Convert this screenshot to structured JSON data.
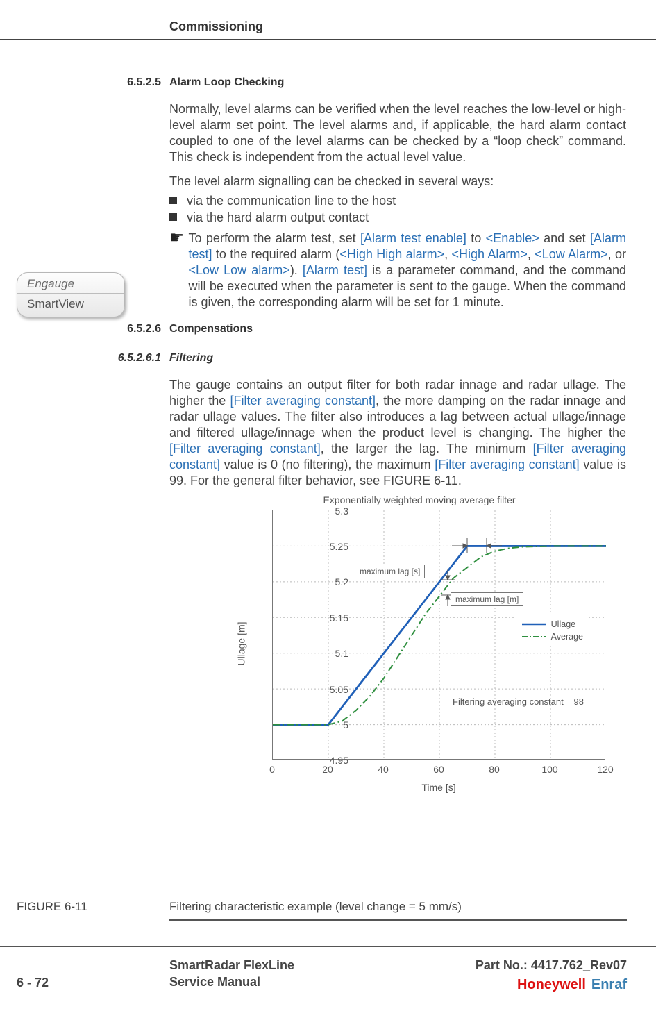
{
  "header": {
    "chapter": "Commissioning"
  },
  "badge": {
    "top": "Engauge",
    "bottom": "SmartView"
  },
  "s6525": {
    "num": "6.5.2.5",
    "title": "Alarm Loop Checking",
    "p1": "Normally, level alarms can be verified when the level reaches the low-level or high-level alarm set point. The level alarms and, if applicable, the hard alarm contact coupled to one of the level alarms can be checked by a “loop check” command. This check is independent from the actual level value.",
    "p2": "The level alarm signalling can be checked in several ways:",
    "b1": "via the communication line to the host",
    "b2": "via the hard alarm output contact",
    "tip_pre": "To perform the alarm test, set ",
    "tip_k1": "[Alarm test enable]",
    "tip_m1": " to ",
    "tip_k2": "<Enable>",
    "tip_m2": " and set ",
    "tip_k3": "[Alarm test]",
    "tip_m3": " to the required alarm (",
    "tip_k4": "<High High alarm>",
    "tip_m4": ", ",
    "tip_k5": "<High Alarm>",
    "tip_m5": ", ",
    "tip_k6": "<Low Alarm>",
    "tip_m6": ", or ",
    "tip_k7": "<Low Low alarm>",
    "tip_m7": "). ",
    "tip_k8": "[Alarm test]",
    "tip_m8": " is a parameter command, and the command will be executed when the parameter is sent to the gauge. When the command is given, the corresponding alarm will be set for 1 minute."
  },
  "s6526": {
    "num": "6.5.2.6",
    "title": "Compensations"
  },
  "s65261": {
    "num": "6.5.2.6.1",
    "title": "Filtering",
    "p_pre": "The gauge contains an output filter for both radar innage and radar ullage. The higher the ",
    "k1": "[Filter averaging constant]",
    "m1": ", the more damping on the radar innage and radar ullage values. The filter also introduces a lag between actual ullage/innage and filtered ullage/innage when the product level is changing. The higher the ",
    "k2": "[Filter averaging constant]",
    "m2": ", the larger the lag. The minimum ",
    "k3": "[Filter averaging constant]",
    "m3": " value is 0 (no filtering), the maximum ",
    "k4": "[Filter averaging constant]",
    "m4": " value is 99. For the general filter behavior, see FIGURE 6-11."
  },
  "chart_data": {
    "type": "line",
    "title": "Exponentially weighted moving average filter",
    "xlabel": "Time [s]",
    "ylabel": "Ullage [m]",
    "xlim": [
      0,
      120
    ],
    "ylim": [
      4.95,
      5.3
    ],
    "xticks": [
      0,
      20,
      40,
      60,
      80,
      100,
      120
    ],
    "yticks": [
      4.95,
      5.0,
      5.05,
      5.1,
      5.15,
      5.2,
      5.25,
      5.3
    ],
    "series": [
      {
        "name": "Ullage",
        "style": "solid",
        "color": "#2060b8",
        "x": [
          0,
          20,
          70,
          120
        ],
        "y": [
          5.0,
          5.0,
          5.25,
          5.25
        ]
      },
      {
        "name": "Average",
        "style": "dashdot",
        "color": "#2f8f3f",
        "x": [
          0,
          20,
          25,
          30,
          35,
          40,
          45,
          50,
          55,
          60,
          65,
          70,
          75,
          80,
          85,
          90,
          100,
          120
        ],
        "y": [
          5.0,
          5.0,
          5.005,
          5.02,
          5.04,
          5.065,
          5.095,
          5.125,
          5.155,
          5.18,
          5.205,
          5.22,
          5.235,
          5.243,
          5.247,
          5.249,
          5.25,
          5.25
        ]
      }
    ],
    "annotations": {
      "max_lag_s": "maximum lag [s]",
      "max_lag_m": "maximum lag [m]",
      "note": "Filtering averaging constant = 98"
    },
    "legend": [
      "Ullage",
      "Average"
    ]
  },
  "figure": {
    "label": "FIGURE  6-11",
    "caption": "Filtering characteristic example (level change = 5 mm/s)"
  },
  "footer": {
    "page": "6 - 72",
    "doc1": "SmartRadar FlexLine",
    "doc2": "Service Manual",
    "part": "Part No.: 4417.762_Rev07",
    "logo1": "Honeywell",
    "logo2": "Enraf"
  }
}
